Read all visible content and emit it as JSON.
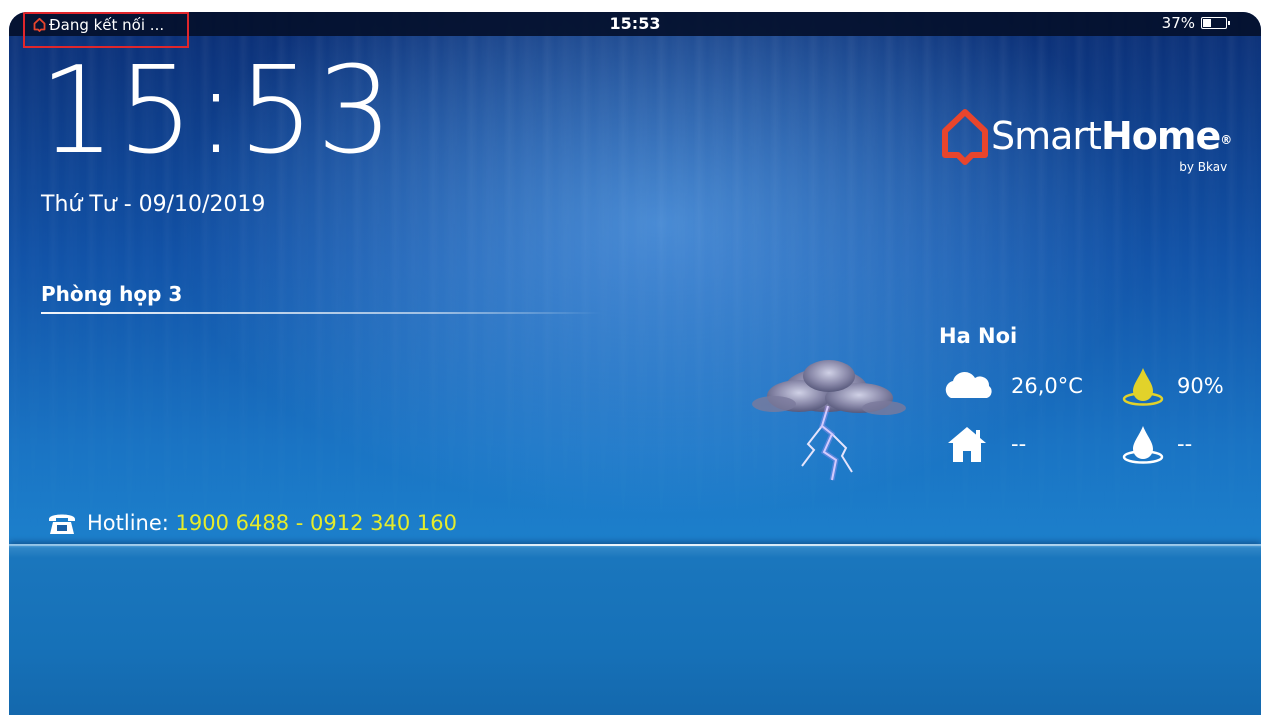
{
  "status_bar": {
    "connection_text": "Đang kết nối ...",
    "time": "15:53",
    "battery_percent_label": "37%",
    "battery_level": 0.37
  },
  "clock": {
    "time": "15:53",
    "date": "Thứ Tư - 09/10/2019"
  },
  "room": {
    "name": "Phòng họp 3"
  },
  "logo": {
    "brand_light": "Smart",
    "brand_bold": "Home",
    "registered": "®",
    "by": "by Bkav",
    "accent_color": "#e8452c"
  },
  "weather": {
    "city": "Ha Noi",
    "condition_icon": "thunderstorm-icon",
    "outdoor_temperature": "26,0°C",
    "outdoor_humidity": "90%",
    "indoor_temperature": "--",
    "indoor_humidity": "--"
  },
  "hotline": {
    "label": "Hotline: ",
    "numbers": "1900 6488 - 0912 340 160"
  }
}
